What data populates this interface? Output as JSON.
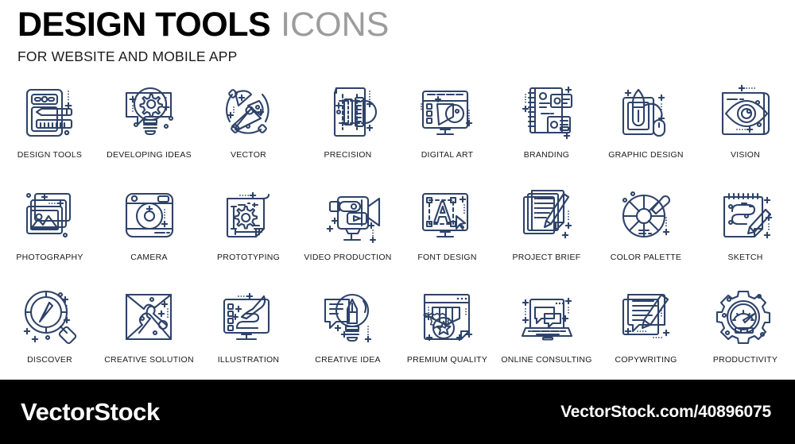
{
  "header": {
    "title_main": "DESIGN TOOLS",
    "title_sub": "ICONS",
    "tagline": "FOR WEBSITE AND MOBILE APP"
  },
  "colors": {
    "icon_stroke": "#2e4369",
    "title_main": "#000000",
    "title_sub": "#9c9c9c",
    "label": "#1a1a1a",
    "footer_background": "#000000",
    "footer_text": "#ffffff",
    "page_background": "#ffffff"
  },
  "grid": {
    "columns": 8,
    "rows": 3,
    "items": [
      {
        "label": "DESIGN TOOLS",
        "icon": "design-tools-icon"
      },
      {
        "label": "DEVELOPING IDEAS",
        "icon": "developing-ideas-icon"
      },
      {
        "label": "VECTOR",
        "icon": "vector-icon"
      },
      {
        "label": "PRECISION",
        "icon": "precision-icon"
      },
      {
        "label": "DIGITAL ART",
        "icon": "digital-art-icon"
      },
      {
        "label": "BRANDING",
        "icon": "branding-icon"
      },
      {
        "label": "GRAPHIC DESIGN",
        "icon": "graphic-design-icon"
      },
      {
        "label": "VISION",
        "icon": "vision-icon"
      },
      {
        "label": "PHOTOGRAPHY",
        "icon": "photography-icon"
      },
      {
        "label": "CAMERA",
        "icon": "camera-icon"
      },
      {
        "label": "PROTOTYPING",
        "icon": "prototyping-icon"
      },
      {
        "label": "VIDEO PRODUCTION",
        "icon": "video-production-icon"
      },
      {
        "label": "FONT DESIGN",
        "icon": "font-design-icon"
      },
      {
        "label": "PROJECT BRIEF",
        "icon": "project-brief-icon"
      },
      {
        "label": "COLOR PALETTE",
        "icon": "color-palette-icon"
      },
      {
        "label": "SKETCH",
        "icon": "sketch-icon"
      },
      {
        "label": "DISCOVER",
        "icon": "discover-icon"
      },
      {
        "label": "CREATIVE SOLUTION",
        "icon": "creative-solution-icon"
      },
      {
        "label": "ILLUSTRATION",
        "icon": "illustration-icon"
      },
      {
        "label": "CREATIVE IDEA",
        "icon": "creative-idea-icon"
      },
      {
        "label": "PREMIUM QUALITY",
        "icon": "premium-quality-icon"
      },
      {
        "label": "ONLINE CONSULTING",
        "icon": "online-consulting-icon"
      },
      {
        "label": "COPYWRITING",
        "icon": "copywriting-icon"
      },
      {
        "label": "PRODUCTIVITY",
        "icon": "productivity-icon"
      }
    ]
  },
  "footer": {
    "brand": "VectorStock",
    "url": "VectorStock.com/40896075"
  }
}
